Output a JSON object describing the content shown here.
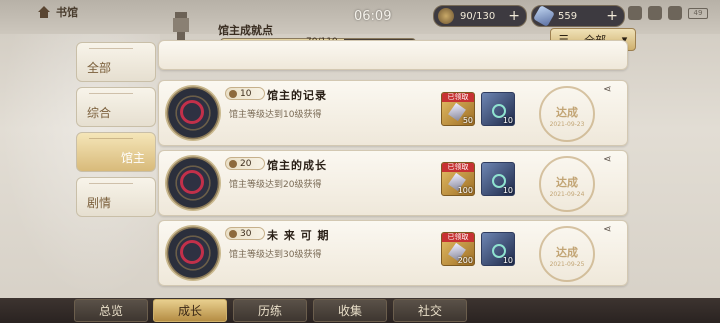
{
  "header": {
    "home_label": "书馆",
    "time": "06:09",
    "resource_1": "90/130",
    "resource_2": "559",
    "battery": "49"
  },
  "progress": {
    "title": "馆主成就点",
    "text": "70/110",
    "fraction": 0.636
  },
  "filter": {
    "label": "全部"
  },
  "side_tabs": [
    {
      "label": "全部"
    },
    {
      "label": "综合"
    },
    {
      "label": "馆主"
    },
    {
      "label": "剧情"
    }
  ],
  "cards": [
    {
      "level": "10",
      "title": "馆主的记录",
      "desc": "馆主等级达到10级获得",
      "reward1_tag": "已领取",
      "reward1_count": "50",
      "reward2_count": "10",
      "stamp": "达成",
      "date": "2021-09-23"
    },
    {
      "level": "20",
      "title": "馆主的成长",
      "desc": "馆主等级达到20级获得",
      "reward1_tag": "已领取",
      "reward1_count": "100",
      "reward2_count": "10",
      "stamp": "达成",
      "date": "2021-09-24"
    },
    {
      "level": "30",
      "title": "未 来 可 期",
      "desc": "馆主等级达到30级获得",
      "reward1_tag": "已领取",
      "reward1_count": "200",
      "reward2_count": "10",
      "stamp": "达成",
      "date": "2021-09-25"
    }
  ],
  "bottom_tabs": [
    {
      "label": "总览"
    },
    {
      "label": "成长"
    },
    {
      "label": "历练"
    },
    {
      "label": "收集"
    },
    {
      "label": "社交"
    }
  ]
}
